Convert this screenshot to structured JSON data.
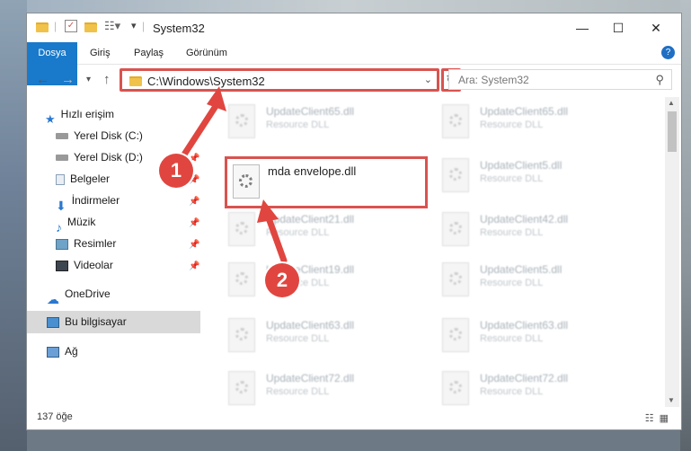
{
  "window": {
    "title": "System32",
    "min": "—",
    "max": "☐",
    "close": "✕"
  },
  "ribbon": {
    "tabs": [
      "Dosya",
      "Giriş",
      "Paylaş",
      "Görünüm"
    ],
    "help": "?"
  },
  "address": {
    "path": "C:\\Windows\\System32",
    "search_placeholder": "Ara: System32"
  },
  "sidebar": {
    "items": [
      {
        "label": "Hızlı erişim",
        "icon": "star-icon"
      },
      {
        "label": "Yerel Disk (C:)",
        "icon": "drive-icon"
      },
      {
        "label": "Yerel Disk (D:)",
        "icon": "drive-icon"
      },
      {
        "label": "Belgeler",
        "icon": "document-icon"
      },
      {
        "label": "İndirmeler",
        "icon": "download-icon"
      },
      {
        "label": "Müzik",
        "icon": "music-icon"
      },
      {
        "label": "Resimler",
        "icon": "pictures-icon"
      },
      {
        "label": "Videolar",
        "icon": "video-icon"
      },
      {
        "label": "OneDrive",
        "icon": "cloud-icon"
      },
      {
        "label": "Bu bilgisayar",
        "icon": "computer-icon"
      },
      {
        "label": "Ağ",
        "icon": "network-icon"
      }
    ]
  },
  "files": {
    "left": [
      {
        "name": "UpdateClient65.dll",
        "type": "Resource DLL"
      },
      {
        "name": "UpdateClient21.dll",
        "type": "Resource DLL"
      },
      {
        "name": "UpdateClient19.dll",
        "type": "Resource DLL"
      },
      {
        "name": "UpdateClient63.dll",
        "type": "Resource DLL"
      },
      {
        "name": "UpdateClient72.dll",
        "type": "Resource DLL"
      }
    ],
    "right": [
      {
        "name": "UpdateClient65.dll",
        "type": "Resource DLL"
      },
      {
        "name": "UpdateClient5.dll",
        "type": "Resource DLL"
      },
      {
        "name": "UpdateClient42.dll",
        "type": "Resource DLL"
      },
      {
        "name": "UpdateClient5.dll",
        "type": "Resource DLL"
      },
      {
        "name": "UpdateClient63.dll",
        "type": "Resource DLL"
      },
      {
        "name": "UpdateClient72.dll",
        "type": "Resource DLL"
      }
    ],
    "highlighted": {
      "name": "mda envelope.dll"
    }
  },
  "status": {
    "count": "137 öğe"
  },
  "annotations": {
    "step1": "1",
    "step2": "2",
    "color": "#e0463f"
  }
}
